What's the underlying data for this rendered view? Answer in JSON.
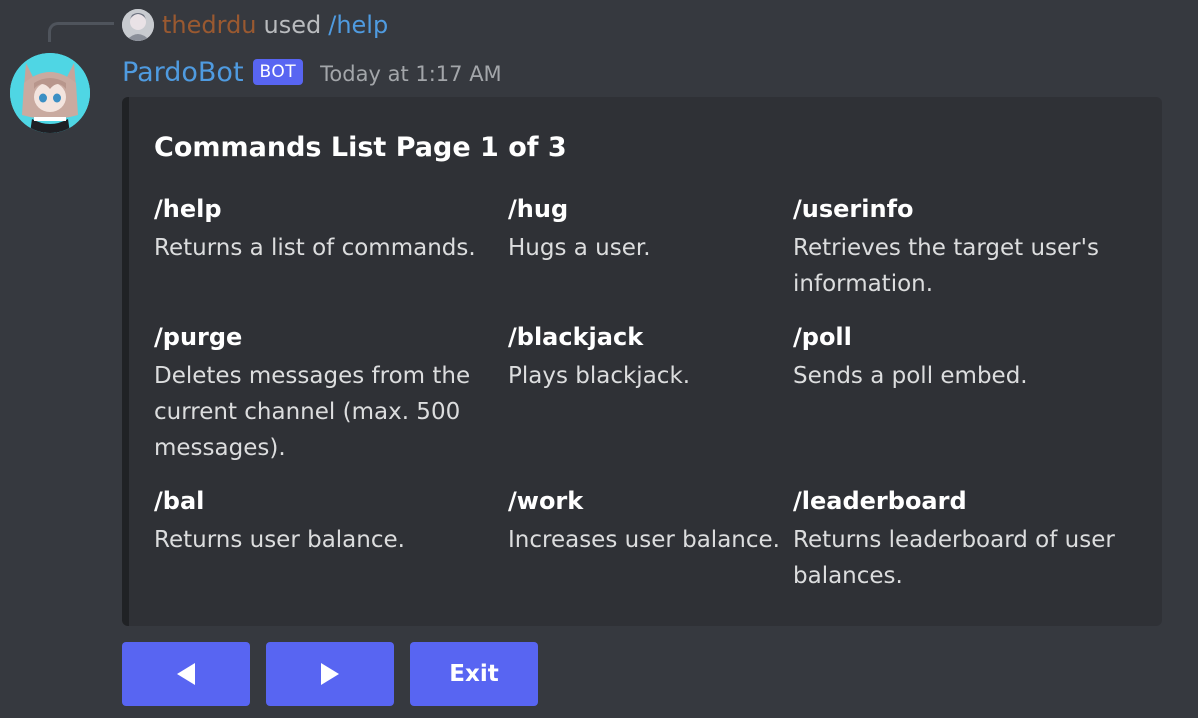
{
  "reply": {
    "username": "thedrdu",
    "used_text": "used",
    "command": "/help"
  },
  "message": {
    "author": "PardoBot",
    "bot_tag": "BOT",
    "timestamp": "Today at 1:17 AM"
  },
  "embed": {
    "title": "Commands List Page 1 of 3",
    "fields": [
      {
        "name": "/help",
        "value": "Returns a list of commands."
      },
      {
        "name": "/hug",
        "value": "Hugs a user."
      },
      {
        "name": "/userinfo",
        "value": "Retrieves the target user's information."
      },
      {
        "name": "/purge",
        "value": "Deletes messages from the current channel (max. 500 messages)."
      },
      {
        "name": "/blackjack",
        "value": "Plays blackjack."
      },
      {
        "name": "/poll",
        "value": "Sends a poll embed."
      },
      {
        "name": "/bal",
        "value": "Returns user balance."
      },
      {
        "name": "/work",
        "value": "Increases user balance."
      },
      {
        "name": "/leaderboard",
        "value": "Returns leaderboard of user balances."
      }
    ]
  },
  "buttons": {
    "previous_icon": "triangle-left-icon",
    "next_icon": "triangle-right-icon",
    "exit_label": "Exit"
  },
  "colors": {
    "background": "#36393f",
    "embed_background": "#2f3136",
    "button": "#5865f2",
    "bot_name": "#4f9be0",
    "reply_username": "#a55d2f"
  }
}
